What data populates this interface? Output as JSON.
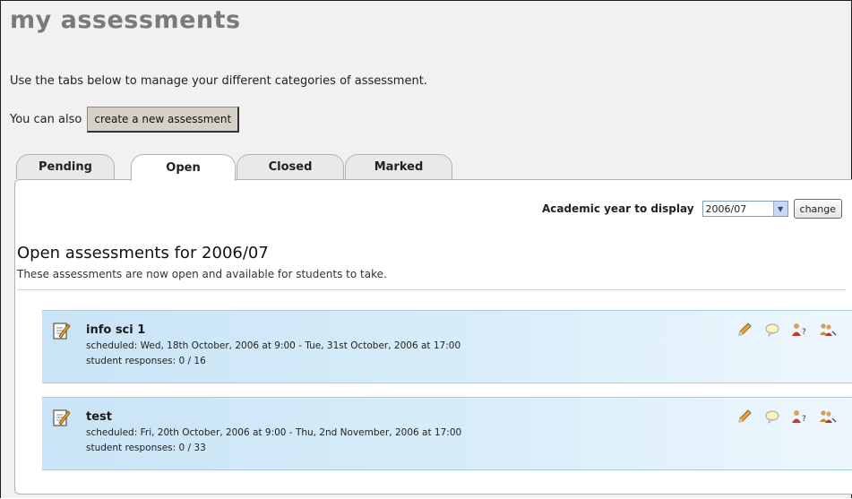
{
  "page": {
    "title": "my assessments",
    "intro": "Use the tabs below to manage your different categories of assessment.",
    "also_prefix": "You can also",
    "create_button": "create a new assessment"
  },
  "tabs": [
    {
      "label": "Pending",
      "active": false
    },
    {
      "label": "Open",
      "active": true
    },
    {
      "label": "Closed",
      "active": false
    },
    {
      "label": "Marked",
      "active": false
    }
  ],
  "filter": {
    "label": "Academic year to display",
    "selected_year": "2006/07",
    "change_button": "change"
  },
  "section": {
    "heading": "Open assessments for 2006/07",
    "subheading": "These assessments are now open and available for students to take."
  },
  "assessments": [
    {
      "name": "info sci 1",
      "scheduled": "scheduled: Wed, 18th October, 2006 at 9:00  -  Tue, 31st October, 2006 at 17:00",
      "responses": "student responses: 0 / 16"
    },
    {
      "name": "test",
      "scheduled": "scheduled: Fri, 20th October, 2006 at 9:00  -  Thu, 2nd November, 2006 at 17:00",
      "responses": "student responses: 0 / 33"
    }
  ],
  "icons": {
    "assessment": "document-edit-icon",
    "actions": [
      "pencil-edit-icon",
      "speech-bubble-icon",
      "user-question-icon",
      "users-marking-icon"
    ]
  },
  "colors": {
    "title": "#7a7a7a",
    "card_gradient_start": "#c9e4f6",
    "card_gradient_end": "#eef7fd",
    "button_bg": "#d6d1c6"
  }
}
